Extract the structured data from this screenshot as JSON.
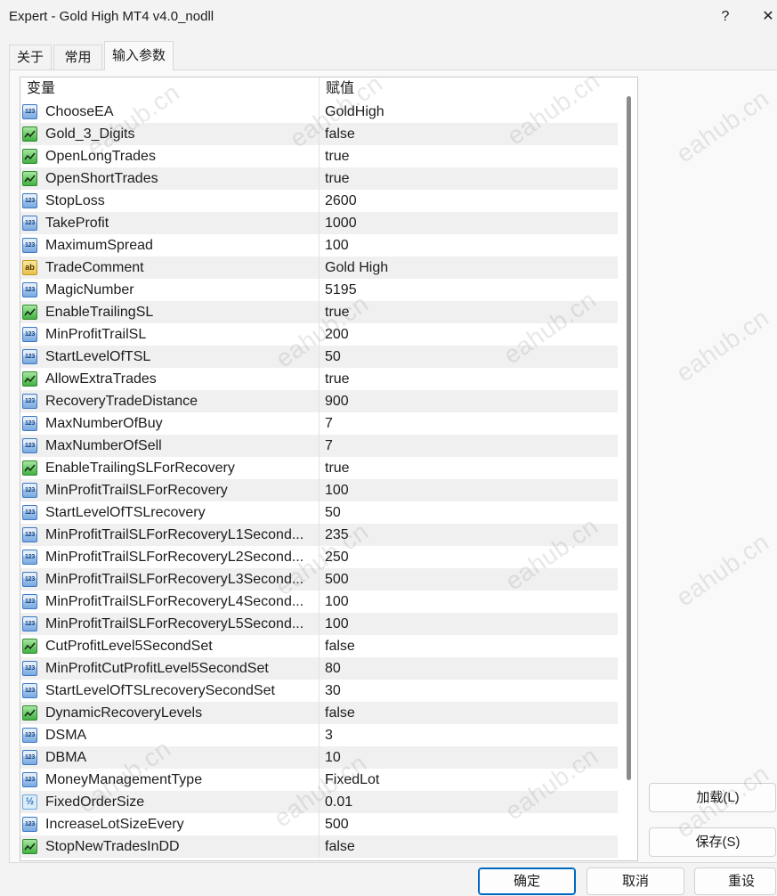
{
  "window": {
    "title": "Expert - Gold High MT4 v4.0_nodll",
    "help_label": "?",
    "close_label": "✕",
    "close_icon": "close-icon"
  },
  "tabs": [
    {
      "label": "关于",
      "selected": false
    },
    {
      "label": "常用",
      "selected": false
    },
    {
      "label": "输入参数",
      "selected": true
    }
  ],
  "table": {
    "columns": [
      "变量",
      "赋值"
    ],
    "rows": [
      {
        "type": "int",
        "name": "ChooseEA",
        "value": "GoldHigh"
      },
      {
        "type": "bool",
        "name": "Gold_3_Digits",
        "value": "false"
      },
      {
        "type": "bool",
        "name": "OpenLongTrades",
        "value": "true"
      },
      {
        "type": "bool",
        "name": "OpenShortTrades",
        "value": "true"
      },
      {
        "type": "int",
        "name": "StopLoss",
        "value": "2600"
      },
      {
        "type": "int",
        "name": "TakeProfit",
        "value": "1000"
      },
      {
        "type": "int",
        "name": "MaximumSpread",
        "value": "100"
      },
      {
        "type": "string",
        "name": "TradeComment",
        "value": "Gold High"
      },
      {
        "type": "int",
        "name": "MagicNumber",
        "value": "5195"
      },
      {
        "type": "bool",
        "name": "EnableTrailingSL",
        "value": "true"
      },
      {
        "type": "int",
        "name": "MinProfitTrailSL",
        "value": "200"
      },
      {
        "type": "int",
        "name": "StartLevelOfTSL",
        "value": "50"
      },
      {
        "type": "bool",
        "name": "AllowExtraTrades",
        "value": "true"
      },
      {
        "type": "int",
        "name": "RecoveryTradeDistance",
        "value": "900"
      },
      {
        "type": "int",
        "name": "MaxNumberOfBuy",
        "value": "7"
      },
      {
        "type": "int",
        "name": "MaxNumberOfSell",
        "value": "7"
      },
      {
        "type": "bool",
        "name": "EnableTrailingSLForRecovery",
        "value": "true"
      },
      {
        "type": "int",
        "name": "MinProfitTrailSLForRecovery",
        "value": "100"
      },
      {
        "type": "int",
        "name": "StartLevelOfTSLrecovery",
        "value": "50"
      },
      {
        "type": "int",
        "name": "MinProfitTrailSLForRecoveryL1Second...",
        "value": "235"
      },
      {
        "type": "int",
        "name": "MinProfitTrailSLForRecoveryL2Second...",
        "value": "250"
      },
      {
        "type": "int",
        "name": "MinProfitTrailSLForRecoveryL3Second...",
        "value": "500"
      },
      {
        "type": "int",
        "name": "MinProfitTrailSLForRecoveryL4Second...",
        "value": "100"
      },
      {
        "type": "int",
        "name": "MinProfitTrailSLForRecoveryL5Second...",
        "value": "100"
      },
      {
        "type": "bool",
        "name": "CutProfitLevel5SecondSet",
        "value": "false"
      },
      {
        "type": "int",
        "name": "MinProfitCutProfitLevel5SecondSet",
        "value": "80"
      },
      {
        "type": "int",
        "name": "StartLevelOfTSLrecoverySecondSet",
        "value": "30"
      },
      {
        "type": "bool",
        "name": "DynamicRecoveryLevels",
        "value": "false"
      },
      {
        "type": "int",
        "name": "DSMA",
        "value": "3"
      },
      {
        "type": "int",
        "name": "DBMA",
        "value": "10"
      },
      {
        "type": "int",
        "name": "MoneyManagementType",
        "value": "FixedLot"
      },
      {
        "type": "double",
        "name": "FixedOrderSize",
        "value": "0.01"
      },
      {
        "type": "int",
        "name": "IncreaseLotSizeEvery",
        "value": "500"
      },
      {
        "type": "bool",
        "name": "StopNewTradesInDD",
        "value": "false"
      }
    ]
  },
  "icons": {
    "int": {
      "name": "integer-type-icon",
      "glyph": "123"
    },
    "bool": {
      "name": "boolean-type-icon"
    },
    "string": {
      "name": "string-type-icon",
      "glyph": "ab"
    },
    "double": {
      "name": "double-type-icon",
      "glyph": "½"
    }
  },
  "side_buttons": {
    "load": "加载(L)",
    "save": "保存(S)"
  },
  "footer": {
    "ok": "确定",
    "cancel": "取消",
    "reset": "重设"
  },
  "watermark": "eahub.cn",
  "colors": {
    "accent": "#0067c0",
    "row_alt": "#f0f0f0",
    "scrollbar_thumb": "#8b8b8b"
  }
}
